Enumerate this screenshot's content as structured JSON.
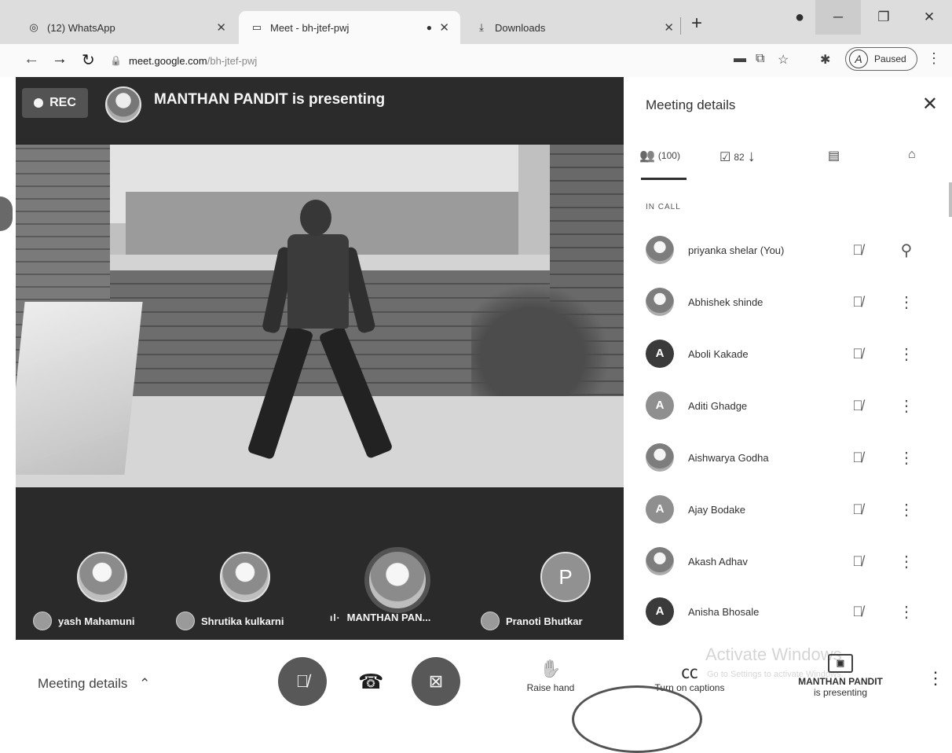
{
  "browser": {
    "tabs": [
      {
        "label": "(12) WhatsApp",
        "icon": "whatsapp-icon"
      },
      {
        "label": "Meet - bh-jtef-pwj",
        "icon": "meet-icon"
      },
      {
        "label": "Downloads",
        "icon": "download-icon"
      }
    ],
    "url_host": "meet.google.com",
    "url_path": "/bh-jtef-pwj",
    "profile_label": "Paused"
  },
  "stage": {
    "rec_label": "REC",
    "presenting_title": "MANTHAN PANDIT is presenting",
    "tiles": [
      {
        "name": "yash Mahamuni"
      },
      {
        "name": "Shrutika kulkarni"
      },
      {
        "name": "MANTHAN PAN..."
      },
      {
        "name": "Pranoti Bhutkar",
        "letter": "P"
      }
    ]
  },
  "panel": {
    "title": "Meeting details",
    "people_count": "(100)",
    "tasks_count": "82",
    "in_call_label": "IN CALL",
    "participants": [
      {
        "name": "priyanka shelar (You)",
        "letter": "",
        "action": "pin"
      },
      {
        "name": "Abhishek shinde",
        "letter": "",
        "action": "more"
      },
      {
        "name": "Aboli Kakade",
        "letter": "A",
        "action": "more"
      },
      {
        "name": "Aditi Ghadge",
        "letter": "A",
        "action": "more"
      },
      {
        "name": "Aishwarya Godha",
        "letter": "",
        "action": "more"
      },
      {
        "name": "Ajay Bodake",
        "letter": "A",
        "action": "more"
      },
      {
        "name": "Akash Adhav",
        "letter": "",
        "action": "more"
      },
      {
        "name": "Anisha Bhosale",
        "letter": "A",
        "action": "more"
      }
    ]
  },
  "bottom": {
    "meeting_details_label": "Meeting details",
    "raise_hand_label": "Raise hand",
    "captions_label": "Turn on captions",
    "presenter_name": "MANTHAN PANDIT",
    "presenter_status": "is presenting",
    "watermark_title": "Activate Windows",
    "watermark_sub": "Go to Settings to activate Windows."
  }
}
